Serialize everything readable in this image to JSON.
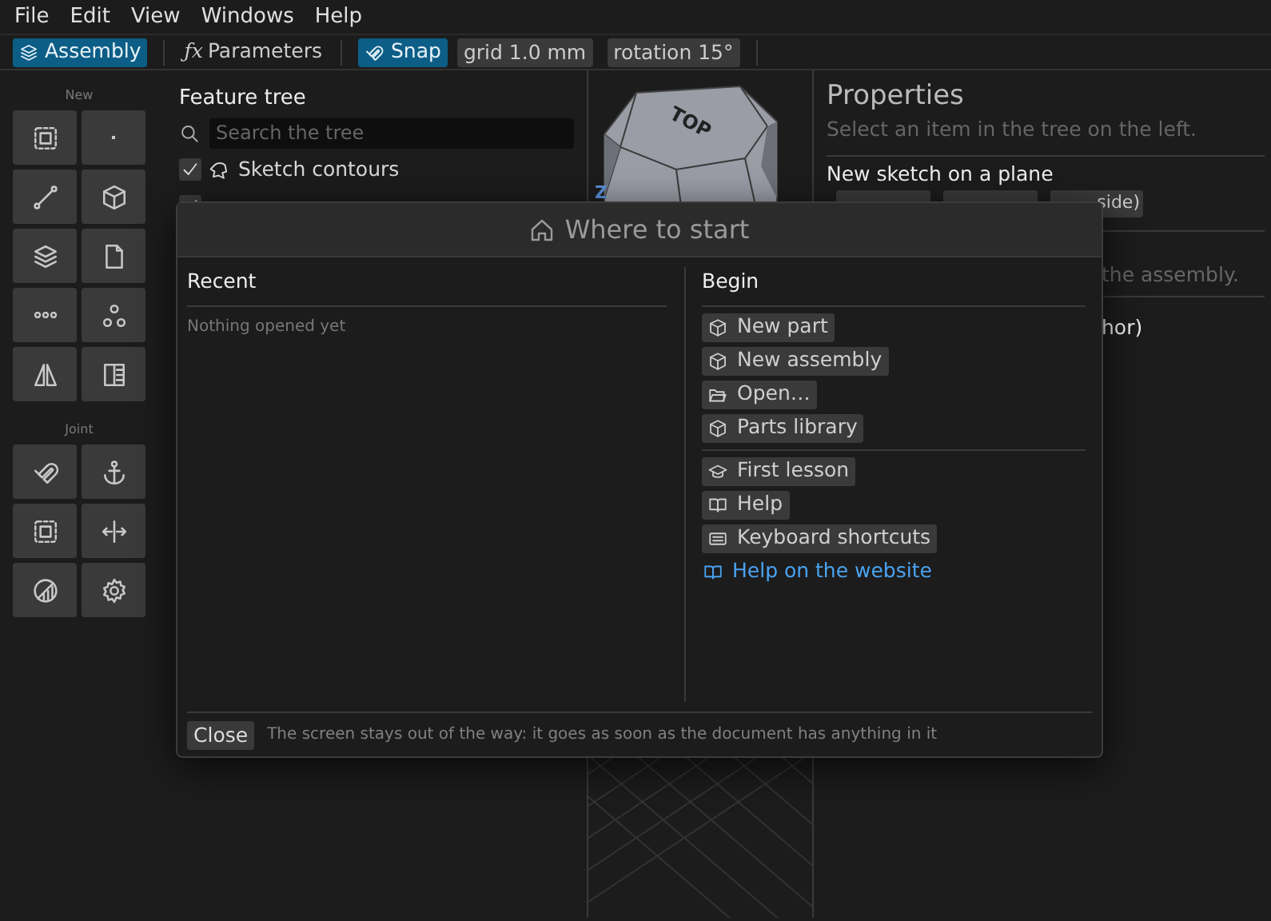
{
  "menu": [
    {
      "label": "File"
    },
    {
      "label": "Edit"
    },
    {
      "label": "View"
    },
    {
      "label": "Windows"
    },
    {
      "label": "Help"
    }
  ],
  "toolbar": {
    "mode": {
      "label": "Assembly",
      "selected": true
    },
    "parameters": {
      "prefix": "ƒx",
      "label": "Parameters"
    },
    "snap": {
      "label": "Snap",
      "on": true
    },
    "grid": "grid 1.0 mm",
    "rotation": "rotation 15°"
  },
  "tool_groups": [
    {
      "label": "New"
    },
    {
      "label": "Joint"
    }
  ],
  "feature_tree": {
    "title": "Feature tree",
    "search": {
      "placeholder": "Search the tree"
    },
    "items": [
      {
        "label": "Sketch contours",
        "checked": true
      },
      {
        "checked": true
      }
    ]
  },
  "viewport": {
    "view_cube": "TOP",
    "axis_label": "Z"
  },
  "properties": {
    "title": "Properties",
    "hint": "Select an item in the tree on the left.",
    "section": "New sketch on a plane",
    "planes": [
      {
        "kind": "chip"
      },
      {
        "kind": "chip"
      },
      {
        "kind": "chip",
        "label": "side)"
      }
    ],
    "partial_texts": [
      "the assembly.",
      "hor)"
    ]
  },
  "dialog": {
    "title": "Where to start",
    "recent": {
      "heading": "Recent",
      "empty": "Nothing opened yet"
    },
    "begin": {
      "heading": "Begin",
      "groups": [
        [
          {
            "label": "New part",
            "kind": "button"
          },
          {
            "label": "New assembly",
            "kind": "button"
          },
          {
            "label": "Open…",
            "kind": "button"
          },
          {
            "label": "Parts library",
            "kind": "button"
          }
        ],
        [
          {
            "label": "First lesson",
            "kind": "button"
          },
          {
            "label": "Help",
            "kind": "button"
          },
          {
            "label": "Keyboard shortcuts",
            "kind": "button"
          },
          {
            "label": "Help on the website",
            "kind": "link"
          }
        ]
      ]
    },
    "close": "Close",
    "footer_note": "The screen stays out of the way: it goes as soon as the document has anything in it"
  }
}
